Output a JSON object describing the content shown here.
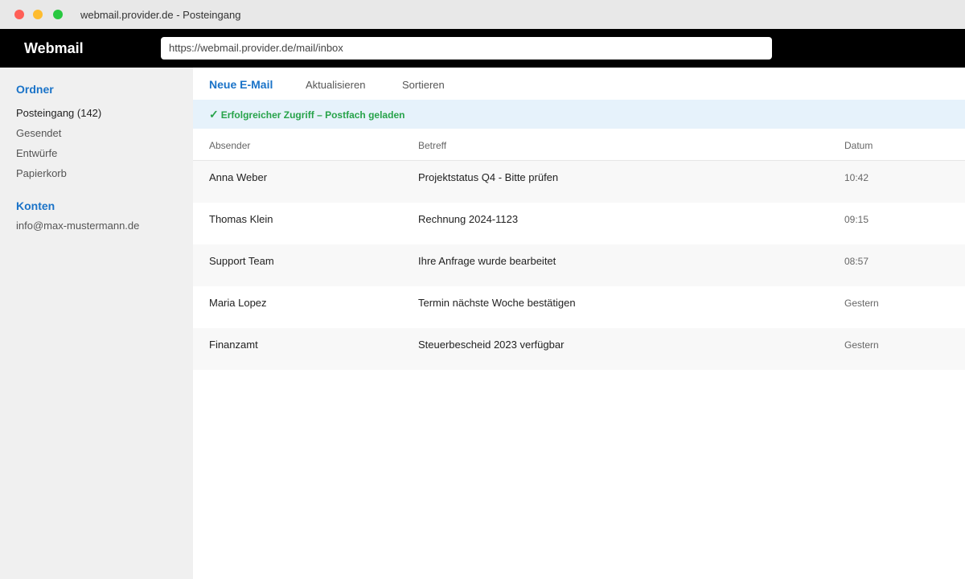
{
  "window": {
    "title": "webmail.provider.de - Posteingang"
  },
  "appbar": {
    "brand": "Webmail",
    "url": "https://webmail.provider.de/mail/inbox"
  },
  "sidebar": {
    "folders_heading": "Ordner",
    "folders": [
      {
        "label": "Posteingang (142)"
      },
      {
        "label": "Gesendet"
      },
      {
        "label": "Entwürfe"
      },
      {
        "label": "Papierkorb"
      }
    ],
    "accounts_heading": "Konten",
    "accounts": [
      {
        "label": "info@max-mustermann.de"
      }
    ]
  },
  "toolbar": {
    "compose_label": "Neue E-Mail",
    "refresh_label": "Aktualisieren",
    "sort_label": "Sortieren"
  },
  "banner": {
    "icon": "check-icon",
    "check": "✓",
    "text": "Erfolgreicher Zugriff – Postfach geladen",
    "color": "#27a34a"
  },
  "table": {
    "headers": {
      "sender": "Absender",
      "subject": "Betreff",
      "date": "Datum"
    },
    "rows": [
      {
        "sender": "Anna Weber",
        "subject": "Projektstatus Q4 - Bitte prüfen",
        "date": "10:42"
      },
      {
        "sender": "Thomas Klein",
        "subject": "Rechnung 2024-1123",
        "date": "09:15"
      },
      {
        "sender": "Support Team",
        "subject": "Ihre Anfrage wurde bearbeitet",
        "date": "08:57"
      },
      {
        "sender": "Maria Lopez",
        "subject": "Termin nächste Woche bestätigen",
        "date": "Gestern"
      },
      {
        "sender": "Finanzamt",
        "subject": "Steuerbescheid 2023 verfügbar",
        "date": "Gestern"
      }
    ]
  },
  "colors": {
    "accent": "#1a73c8",
    "appbar": "#000000",
    "sidebar": "#f0f0f0"
  }
}
